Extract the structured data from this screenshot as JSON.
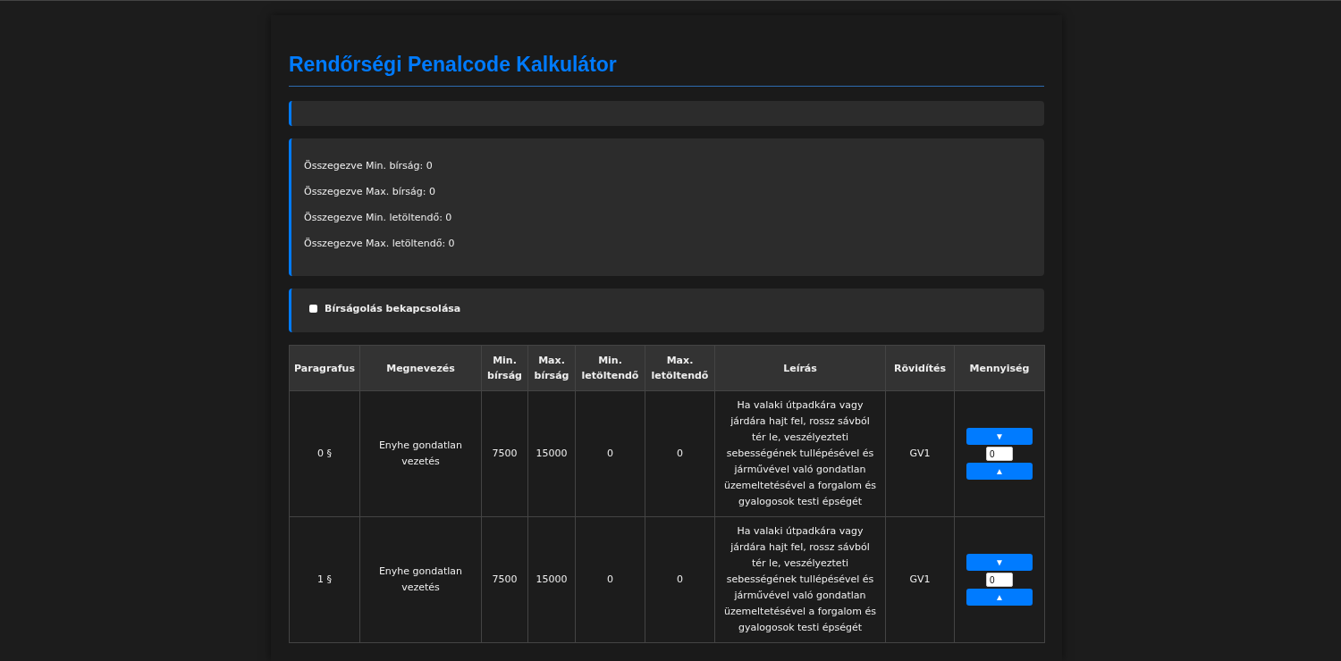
{
  "title": "Rendőrségi Penalcode Kalkulátor",
  "summary": [
    "Összegezve Min. bírság: 0",
    "Összegezve Max. bírság: 0",
    "Összegezve Min. letöltendő: 0",
    "Összegezve Max. letöltendő: 0"
  ],
  "fine_toggle": {
    "label": "Bírságolás bekapcsolása",
    "checked": false
  },
  "table": {
    "columns": [
      "Paragrafus",
      "Megnevezés",
      "Min. bírság",
      "Max. bírság",
      "Min. letöltendő",
      "Max. letöltendő",
      "Leírás",
      "Rövidítés",
      "Mennyiség"
    ],
    "rows": [
      {
        "cells": [
          "0 §",
          "Enyhe gondatlan vezetés",
          "7500",
          "15000",
          "0",
          "0",
          "Ha valaki útpadkára vagy járdára hajt fel, rossz sávból tér le, veszélyezteti sebességének tullépésével és járművével való gondatlan üzemeltetésével a forgalom és gyalogosok testi épségét",
          "GV1"
        ],
        "quantity": "0",
        "down": "▼",
        "up": "▲"
      },
      {
        "cells": [
          "1 §",
          "Enyhe gondatlan vezetés",
          "7500",
          "15000",
          "0",
          "0",
          "Ha valaki útpadkára vagy járdára hajt fel, rossz sávból tér le, veszélyezteti sebességének tullépésével és járművével való gondatlan üzemeltetésével a forgalom és gyalogosok testi épségét",
          "GV1"
        ],
        "quantity": "0",
        "down": "▼",
        "up": "▲"
      }
    ]
  }
}
